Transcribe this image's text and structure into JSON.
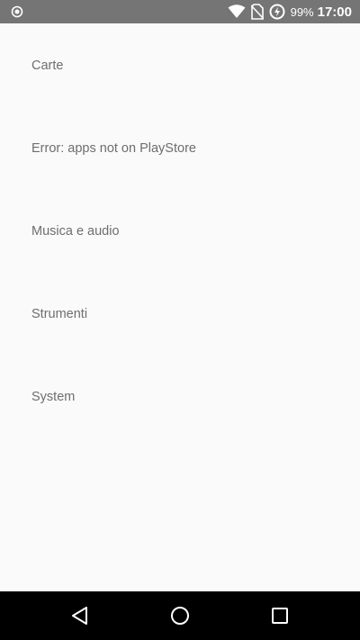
{
  "status_bar": {
    "battery_percent": "99%",
    "time": "17:00",
    "icons": [
      "record-icon",
      "wifi-icon",
      "no-sim-icon",
      "data-saver-icon"
    ]
  },
  "list": {
    "items": [
      {
        "label": "Carte"
      },
      {
        "label": "Error: apps not on PlayStore"
      },
      {
        "label": "Musica e audio"
      },
      {
        "label": "Strumenti"
      },
      {
        "label": "System"
      }
    ]
  },
  "colors": {
    "status_bar_bg": "#757575",
    "background": "#fafafa",
    "text": "#6e6e6e",
    "nav_bar_bg": "#000000"
  },
  "nav_bar": {
    "icons": [
      "back-icon",
      "home-icon",
      "recents-icon"
    ]
  }
}
